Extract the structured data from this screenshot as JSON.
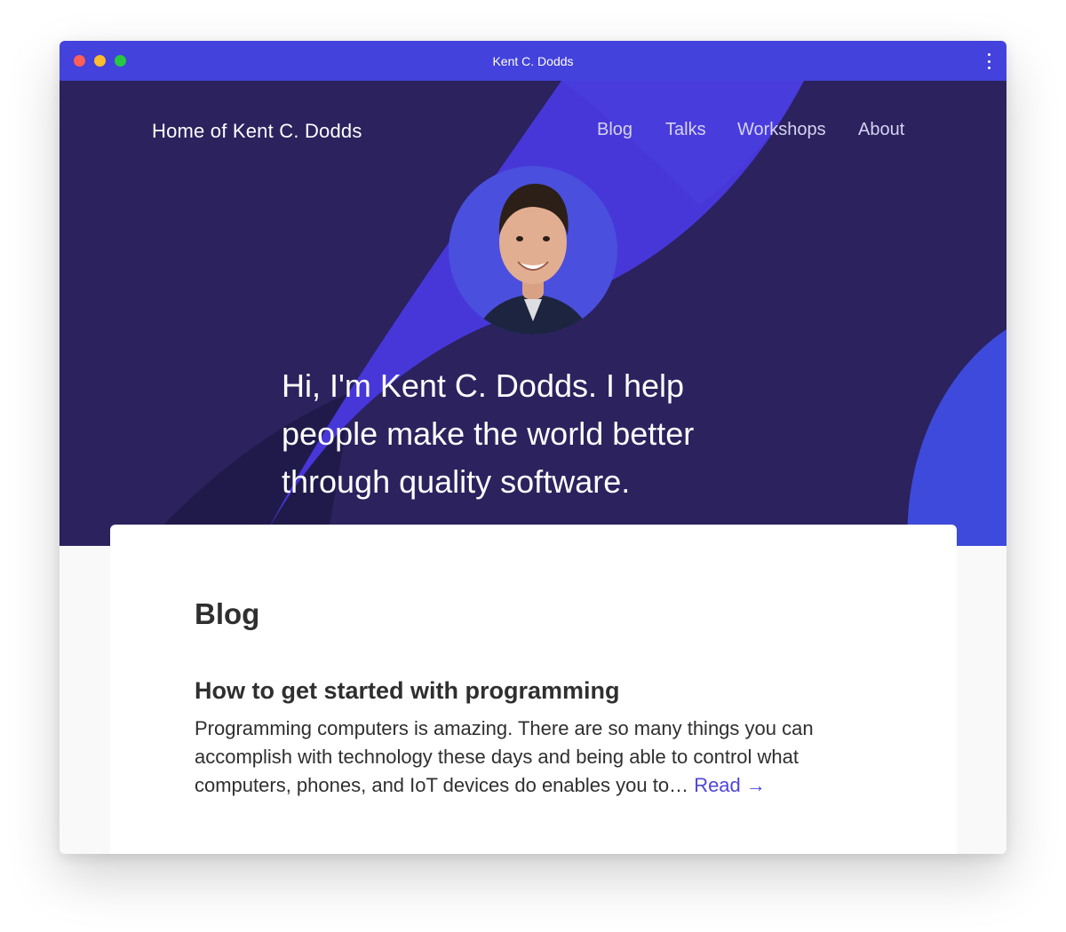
{
  "window": {
    "title": "Kent C. Dodds"
  },
  "header": {
    "site_title": "Home of Kent C. Dodds",
    "nav": [
      {
        "label": "Blog"
      },
      {
        "label": "Talks"
      },
      {
        "label": "Workshops"
      },
      {
        "label": "About"
      }
    ]
  },
  "hero": {
    "avatar_icon": "person-photo",
    "tagline": "Hi, I'm Kent C. Dodds. I help people make the world better through quality software."
  },
  "blog": {
    "heading": "Blog",
    "posts": [
      {
        "title": "How to get started with programming",
        "excerpt": "Programming computers is amazing. There are so many things you can accomplish with technology these days and being able to control what computers, phones, and IoT devices do enables you to…",
        "read_label": "Read →"
      }
    ]
  },
  "colors": {
    "titlebar": "#4342dc",
    "hero_background": "#2b225e",
    "accent": "#4f46d8",
    "text_dark": "#2f2f2f"
  }
}
